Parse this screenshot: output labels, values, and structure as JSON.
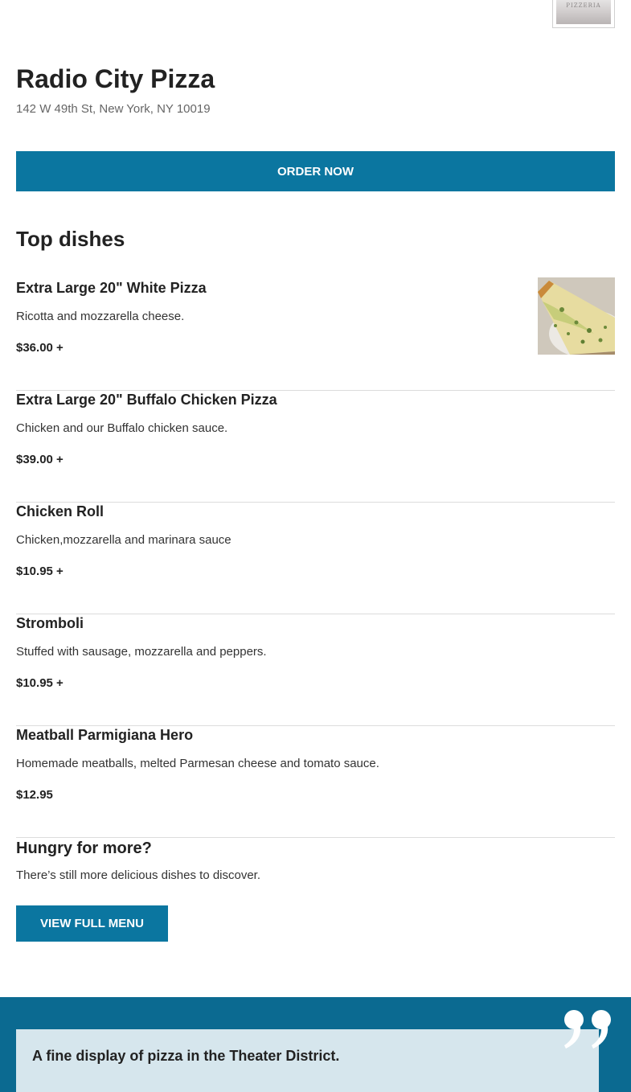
{
  "header": {
    "logo_text": "PIZZERIA",
    "name": "Radio City Pizza",
    "address": "142 W 49th St, New York, NY 10019",
    "order_label": "ORDER NOW"
  },
  "top_dishes": {
    "title": "Top dishes",
    "items": [
      {
        "name": "Extra Large 20\" White Pizza",
        "description": "Ricotta and mozzarella cheese.",
        "price": "$36.00 +",
        "has_photo": true
      },
      {
        "name": "Extra Large 20\" Buffalo Chicken Pizza",
        "description": "Chicken and our Buffalo chicken sauce.",
        "price": "$39.00 +",
        "has_photo": false
      },
      {
        "name": "Chicken Roll",
        "description": "Chicken,mozzarella and marinara sauce",
        "price": "$10.95 +",
        "has_photo": false
      },
      {
        "name": "Stromboli",
        "description": "Stuffed with sausage, mozzarella and peppers.",
        "price": "$10.95 +",
        "has_photo": false
      },
      {
        "name": "Meatball Parmigiana Hero",
        "description": "Homemade meatballs, melted Parmesan cheese and tomato sauce.",
        "price": "$12.95",
        "has_photo": false
      }
    ]
  },
  "more": {
    "title": "Hungry for more?",
    "text": "There’s still more delicious dishes to discover.",
    "button_label": "VIEW FULL MENU"
  },
  "review": {
    "text": "A fine display of pizza in the Theater District.",
    "icon": "quote-icon"
  },
  "colors": {
    "accent": "#0b76a0",
    "review_band": "#0b6a91",
    "review_card": "#d6e6ed"
  }
}
